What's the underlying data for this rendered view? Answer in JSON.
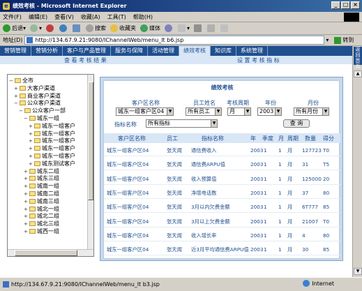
{
  "window": {
    "title": "绩效考核 - Microsoft Internet Explorer"
  },
  "menu": [
    "文件(F)",
    "编辑(E)",
    "查看(V)",
    "收藏(A)",
    "工具(T)",
    "帮助(H)"
  ],
  "toolbar": {
    "back": "后退",
    "search": "搜索",
    "favorites": "收藏夹",
    "media": "媒体"
  },
  "address": {
    "label": "地址(D)",
    "url": "http://134.67.9.21:9080/IChannelWeb/menu_lt b6.jsp",
    "go": "转到"
  },
  "nav": {
    "items": [
      "营销管理",
      "营销分析",
      "客户与产品管理",
      "服务与保障",
      "活动管理",
      "绩效考核",
      "知识库",
      "系统管理"
    ],
    "active_index": 5,
    "sub_left": "查 看 考 核 结 果",
    "sub_right": "设 置 考 核 指 标",
    "return_label": "返回首页"
  },
  "tree": [
    {
      "label": "全市",
      "level": 0,
      "exp": "−"
    },
    {
      "label": "大客户渠道",
      "level": 1,
      "exp": "+"
    },
    {
      "label": "商业客户渠道",
      "level": 1,
      "exp": "+"
    },
    {
      "label": "公众客户渠道",
      "level": 1,
      "exp": "−"
    },
    {
      "label": "公众客户一部",
      "level": 2,
      "exp": "−"
    },
    {
      "label": "城东一组",
      "level": 3,
      "exp": "−"
    },
    {
      "label": "城东一组客户",
      "level": 4,
      "exp": "+"
    },
    {
      "label": "城东一组客户",
      "level": 4,
      "exp": "+"
    },
    {
      "label": "城东一组客户",
      "level": 4,
      "exp": "+"
    },
    {
      "label": "城东一组客户",
      "level": 4,
      "exp": "+"
    },
    {
      "label": "城东一组客户",
      "level": 4,
      "exp": "+"
    },
    {
      "label": "城东测试客户",
      "level": 4,
      "exp": "+"
    },
    {
      "label": "城东二组",
      "level": 3,
      "exp": "+"
    },
    {
      "label": "城东三组",
      "level": 3,
      "exp": "+"
    },
    {
      "label": "城南一组",
      "level": 3,
      "exp": "+"
    },
    {
      "label": "城南二组",
      "level": 3,
      "exp": "+"
    },
    {
      "label": "城南三组",
      "level": 3,
      "exp": "+"
    },
    {
      "label": "城北一组",
      "level": 3,
      "exp": "+"
    },
    {
      "label": "城北二组",
      "level": 3,
      "exp": "+"
    },
    {
      "label": "城北三组",
      "level": 3,
      "exp": "+"
    },
    {
      "label": "城西一组",
      "level": 3,
      "exp": "+"
    }
  ],
  "panel": {
    "title": "绩效考核",
    "filter_labels": {
      "customer_area": "客户区名称",
      "staff": "员工姓名",
      "period": "考核周期",
      "year": "年份",
      "month": "月份",
      "indicator": "指标名称"
    },
    "filter_values": {
      "customer_area": "城东一组客户区04",
      "staff": "所有员工",
      "period": "月",
      "year": "2003",
      "month": "所有月份",
      "indicator": "所有指标"
    },
    "query_button": "查 询",
    "columns": [
      "客户区名称",
      "员工",
      "指标名称",
      "年",
      "季度",
      "月",
      "周期",
      "数量",
      "得分"
    ],
    "rows": [
      [
        "城东一组客户区04",
        "张天闻",
        "通信费收入",
        "2003",
        "1",
        "1",
        "月",
        "127723",
        "T0"
      ],
      [
        "城东一组客户区04",
        "张天闻",
        "通信费ARPU值",
        "2003",
        "1",
        "1",
        "月",
        "31",
        "T5"
      ],
      [
        "城东一组客户区04",
        "张天闻",
        "收入预算值",
        "2003",
        "1",
        "1",
        "月",
        "125000",
        "20"
      ],
      [
        "城东一组客户区04",
        "张天闻",
        "净增电话数",
        "2003",
        "1",
        "1",
        "月",
        "37",
        "80"
      ],
      [
        "城东一组客户区04",
        "张天闻",
        "3月以内欠费金额",
        "2003",
        "1",
        "1",
        "月",
        "6T777",
        "85"
      ],
      [
        "城东一组客户区04",
        "张天闻",
        "3月以上欠费金额",
        "2003",
        "1",
        "1",
        "月",
        "21007",
        "T0"
      ],
      [
        "城东一组客户区04",
        "张天闻",
        "收入增长率",
        "2003",
        "1",
        "1",
        "月",
        "4",
        "80"
      ],
      [
        "城东一组客户区04",
        "张天闻",
        "近3月平均通信费ARPU值",
        "2003",
        "1",
        "1",
        "月",
        "30",
        "85"
      ]
    ]
  },
  "status": {
    "url": "http://134.67.9.21:9080/IChannelWeb/menu_lt b3.jsp",
    "zone": "Internet"
  }
}
